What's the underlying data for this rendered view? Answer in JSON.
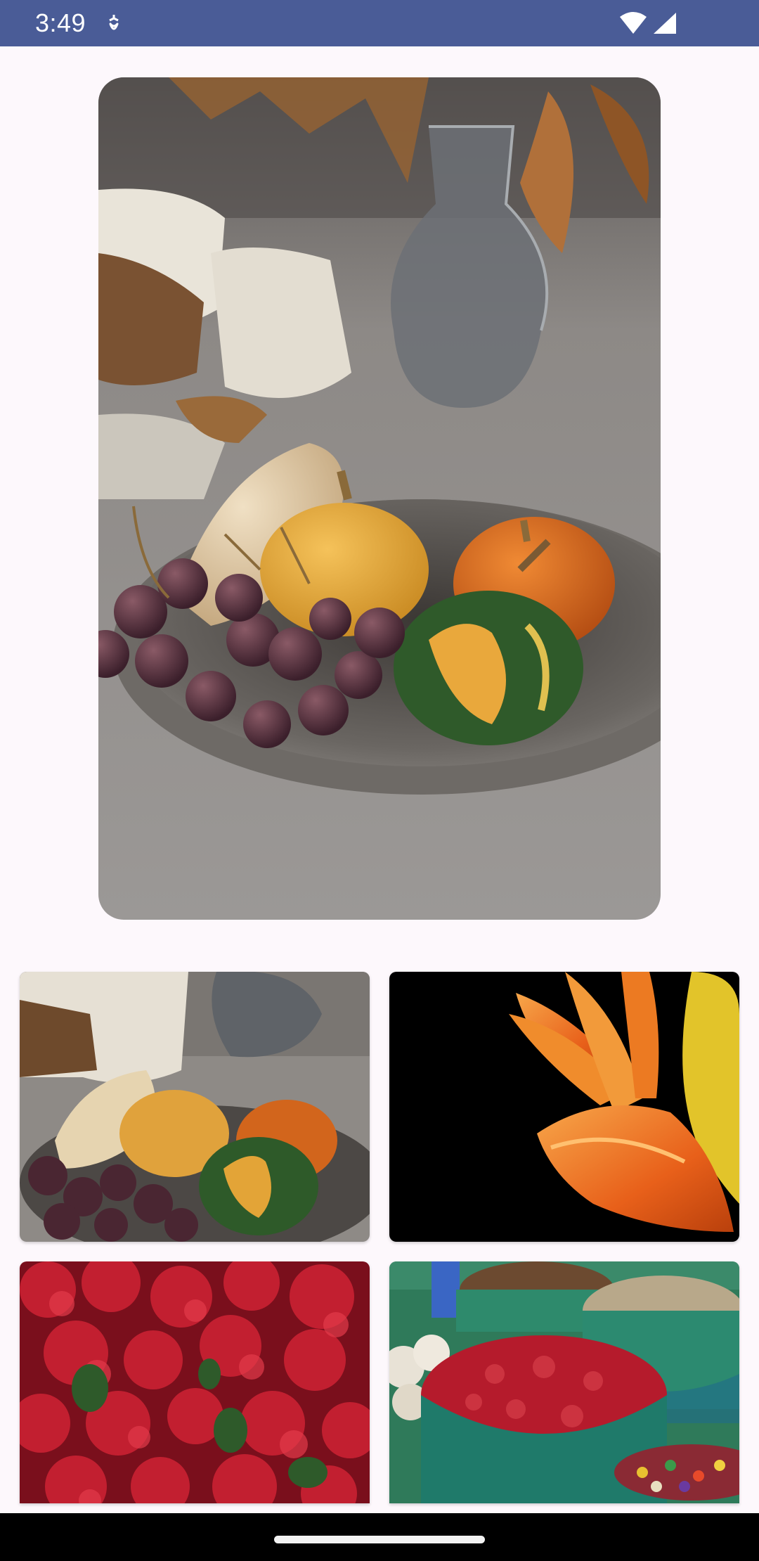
{
  "status_bar": {
    "time": "3:49",
    "icons": [
      "notification-icon",
      "wifi-icon",
      "cellular-signal-icon"
    ],
    "background": "#4a5c97"
  },
  "gallery": {
    "hero": {
      "subject": "pumpkins-grapes-plate",
      "selected": true
    },
    "thumbnails": [
      {
        "subject": "pumpkins-grapes-plate"
      },
      {
        "subject": "orange-lily-flower"
      },
      {
        "subject": "red-bougainvillea"
      },
      {
        "subject": "spice-baskets-market"
      }
    ]
  },
  "navigation": {
    "handle": "home-gesture-handle"
  }
}
